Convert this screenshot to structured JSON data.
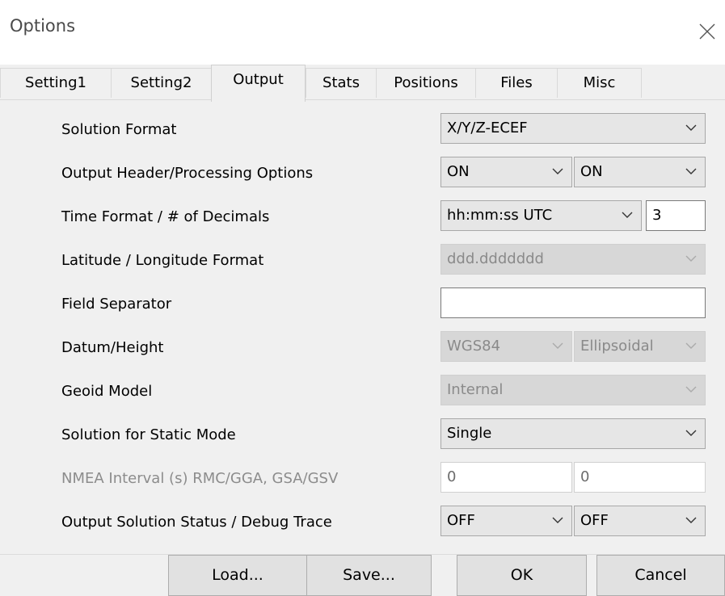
{
  "window": {
    "title": "Options",
    "close_icon": "close-icon"
  },
  "tabs": [
    {
      "label": "Setting1"
    },
    {
      "label": "Setting2"
    },
    {
      "label": "Output",
      "active": true
    },
    {
      "label": "Stats"
    },
    {
      "label": "Positions"
    },
    {
      "label": "Files"
    },
    {
      "label": "Misc"
    }
  ],
  "fields": {
    "solution_format": {
      "label": "Solution Format",
      "value": "X/Y/Z-ECEF"
    },
    "output_header": {
      "label": "Output Header/Processing Options",
      "value1": "ON",
      "value2": "ON"
    },
    "time_format": {
      "label": "Time Format / # of Decimals",
      "value": "hh:mm:ss UTC",
      "decimals": "3"
    },
    "latlon_format": {
      "label": "Latitude / Longitude Format",
      "value": "ddd.ddddddd"
    },
    "field_separator": {
      "label": "Field Separator",
      "value": ""
    },
    "datum_height": {
      "label": "Datum/Height",
      "datum": "WGS84",
      "height": "Ellipsoidal"
    },
    "geoid_model": {
      "label": "Geoid Model",
      "value": "Internal"
    },
    "static_solution": {
      "label": "Solution for Static Mode",
      "value": "Single"
    },
    "nmea_interval": {
      "label": "NMEA Interval (s) RMC/GGA, GSA/GSV",
      "value1": "0",
      "value2": "0"
    },
    "solution_status": {
      "label": "Output Solution Status / Debug Trace",
      "status": "OFF",
      "trace": "OFF"
    }
  },
  "buttons": {
    "load": "Load...",
    "save": "Save...",
    "ok": "OK",
    "cancel": "Cancel"
  },
  "colors": {
    "window_bg": "#f0f0f0",
    "combo_bg": "#e6e6e6",
    "disabled_bg": "#d7d7d7",
    "disabled_text": "#8a8a8a"
  }
}
